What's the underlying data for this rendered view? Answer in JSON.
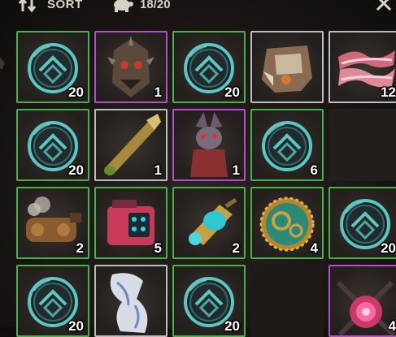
{
  "toolbar": {
    "sort_label": "SORT",
    "capacity_label": "18/20",
    "sort_icon": "sort-arrows-icon",
    "capacity_icon": "turtle-icon",
    "close_icon": "close-icon"
  },
  "colors": {
    "uncommon": "#4bb04a",
    "epic": "#b44fc8",
    "common": "#bdbdbd",
    "coin": "#5bc7c4"
  },
  "slots": [
    {
      "item": "coin",
      "qty": "20",
      "rarity": "uncommon"
    },
    {
      "item": "spiked-mask",
      "qty": "1",
      "rarity": "epic"
    },
    {
      "item": "coin",
      "qty": "20",
      "rarity": "uncommon"
    },
    {
      "item": "armor-chestplate",
      "qty": "",
      "rarity": "common"
    },
    {
      "item": "bacon",
      "qty": "12",
      "rarity": "common"
    },
    {
      "item": "coin",
      "qty": "20",
      "rarity": "uncommon"
    },
    {
      "item": "brass-cartridge",
      "qty": "1",
      "rarity": "common"
    },
    {
      "item": "rat-bust",
      "qty": "1",
      "rarity": "epic"
    },
    {
      "item": "coin",
      "qty": "6",
      "rarity": "uncommon"
    },
    {
      "item": "",
      "qty": "",
      "rarity": "empty"
    },
    {
      "item": "steam-engine",
      "qty": "2",
      "rarity": "uncommon"
    },
    {
      "item": "battery-box",
      "qty": "5",
      "rarity": "uncommon"
    },
    {
      "item": "glowing-canister",
      "qty": "2",
      "rarity": "uncommon"
    },
    {
      "item": "gear-clockwork",
      "qty": "4",
      "rarity": "uncommon"
    },
    {
      "item": "coin",
      "qty": "20",
      "rarity": "uncommon"
    },
    {
      "item": "coin",
      "qty": "20",
      "rarity": "uncommon"
    },
    {
      "item": "cloth-scrap",
      "qty": "",
      "rarity": "common"
    },
    {
      "item": "coin",
      "qty": "20",
      "rarity": "uncommon"
    },
    {
      "item": "",
      "qty": "",
      "rarity": "empty"
    },
    {
      "item": "pink-orb-flower",
      "qty": "4",
      "rarity": "epic"
    }
  ]
}
